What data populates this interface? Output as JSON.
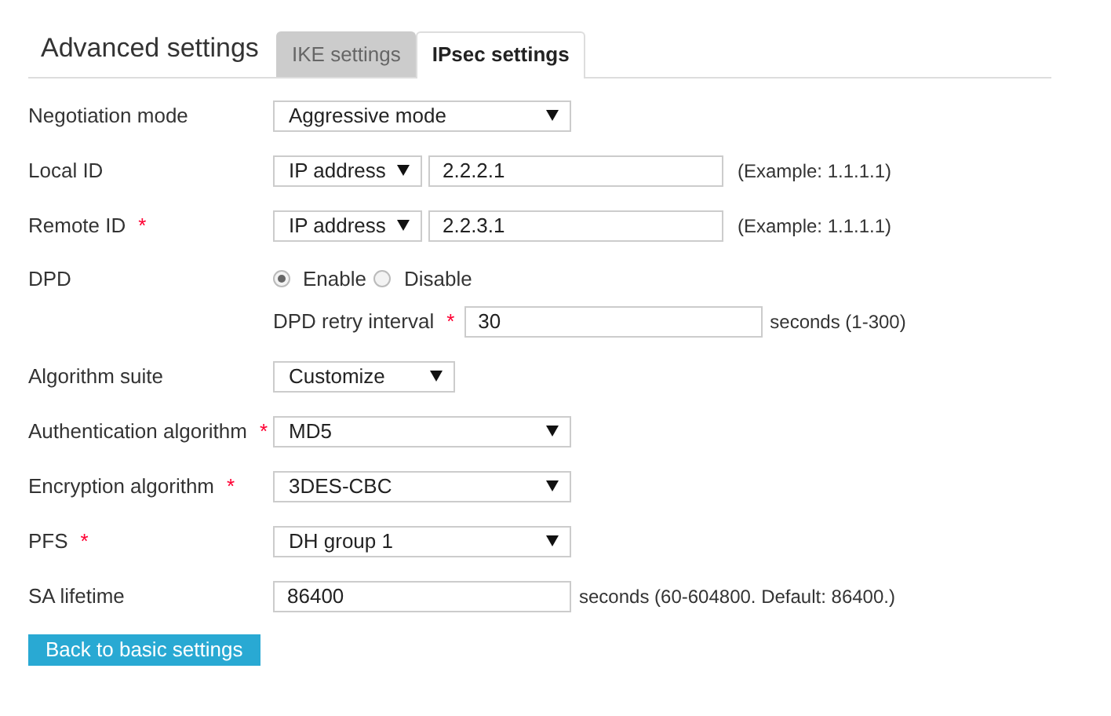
{
  "heading": "Advanced settings",
  "tabs": [
    {
      "label": "IKE settings",
      "selected": false
    },
    {
      "label": "IPsec settings",
      "selected": true
    }
  ],
  "rows": [
    {
      "kind": "select",
      "label": "Negotiation mode",
      "value": "Aggressive mode"
    },
    {
      "kind": "id",
      "label": "Local ID",
      "type": "IP address",
      "value": "2.2.2.1",
      "hint": "(Example: 1.1.1.1)"
    },
    {
      "kind": "id",
      "label": "Remote ID",
      "required_mark": "*",
      "type": "IP address",
      "value": "2.2.3.1",
      "hint": "(Example: 1.1.1.1)"
    },
    {
      "kind": "radio",
      "label": "DPD",
      "options": [
        {
          "label": "Enable",
          "selected": true
        },
        {
          "label": "Disable",
          "selected": false
        }
      ]
    },
    {
      "kind": "subfield",
      "label": "DPD retry interval",
      "required_mark": "*",
      "value": "30",
      "hint": "seconds (1-300)"
    },
    {
      "kind": "short_select",
      "label": "Algorithm suite",
      "value": "Customize"
    },
    {
      "kind": "select",
      "label": "Authentication algorithm",
      "required_mark": "*",
      "value": "MD5"
    },
    {
      "kind": "select",
      "label": "Encryption algorithm",
      "required_mark": "*",
      "value": "3DES-CBC"
    },
    {
      "kind": "select",
      "label": "PFS",
      "required_mark": "*",
      "value": "DH group 1"
    },
    {
      "kind": "input",
      "label": "SA lifetime",
      "value": "86400",
      "hint": "seconds (60-604800. Default: 86400.)"
    }
  ],
  "button": "Back to basic settings"
}
